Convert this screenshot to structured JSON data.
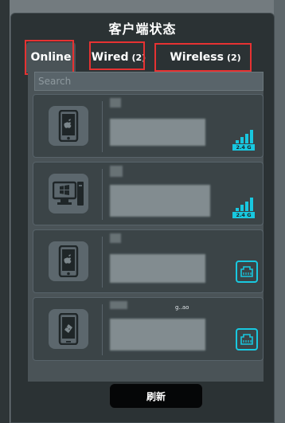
{
  "window": {
    "title": "客户端状态"
  },
  "tabs": [
    {
      "label": "Online",
      "count": ""
    },
    {
      "label": "Wired",
      "count": "(2)"
    },
    {
      "label": "Wireless",
      "count": "(2)"
    }
  ],
  "search": {
    "placeholder": "Search"
  },
  "clients": [
    {
      "device_icon": "apple-phone-icon",
      "connection": "wireless",
      "band": "2.4 G",
      "extra_text": ""
    },
    {
      "device_icon": "windows-desktop-icon",
      "connection": "wireless",
      "band": "2.4 G",
      "extra_text": ""
    },
    {
      "device_icon": "apple-phone-icon",
      "connection": "wired",
      "band": "",
      "extra_text": ""
    },
    {
      "device_icon": "android-phone-icon",
      "connection": "wired",
      "band": "",
      "extra_text": "g..ao"
    }
  ],
  "footer": {
    "refresh_label": "刷新"
  },
  "colors": {
    "accent": "#18c8e0",
    "highlight_box": "#e63232",
    "panel": "#2b3234"
  }
}
